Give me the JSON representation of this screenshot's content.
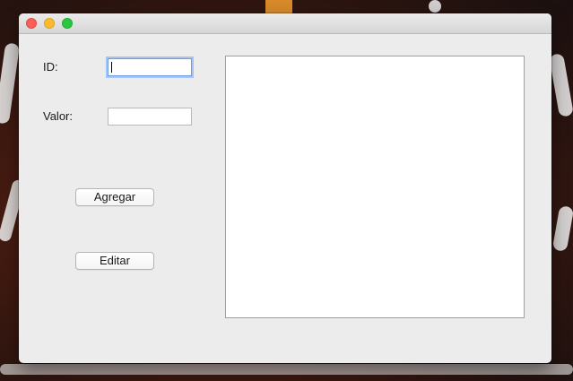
{
  "window": {
    "buttons": [
      "close",
      "minimize",
      "zoom"
    ],
    "colors": {
      "close": "#fc5f57",
      "minimize": "#fdbc2e",
      "zoom": "#28c840",
      "focus_ring": "#6e9fe2"
    }
  },
  "form": {
    "id_label": "ID:",
    "id_value": "",
    "valor_label": "Valor:",
    "valor_value": ""
  },
  "actions": {
    "add_label": "Agregar",
    "edit_label": "Editar"
  },
  "output": {
    "text": ""
  }
}
